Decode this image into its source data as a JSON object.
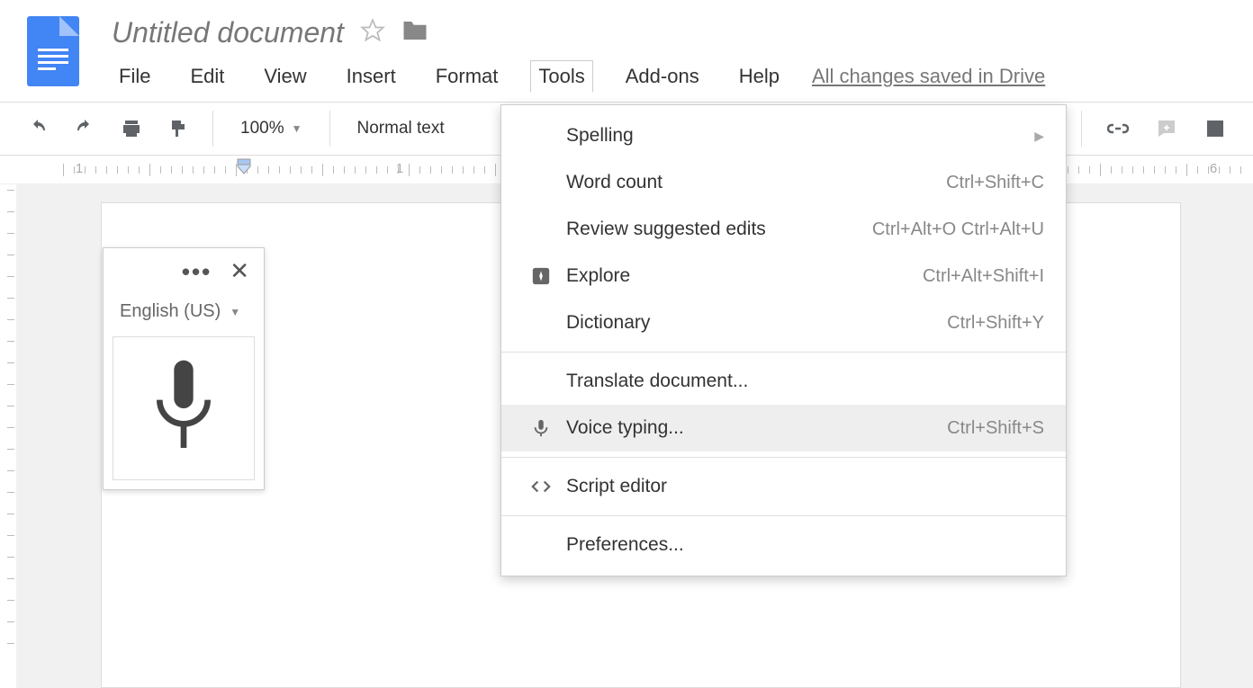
{
  "doc": {
    "title": "Untitled document",
    "save_status": "All changes saved in Drive"
  },
  "menus": {
    "file": "File",
    "edit": "Edit",
    "view": "View",
    "insert": "Insert",
    "format": "Format",
    "tools": "Tools",
    "addons": "Add-ons",
    "help": "Help"
  },
  "toolbar": {
    "zoom": "100%",
    "style": "Normal text"
  },
  "voice_panel": {
    "language": "English (US)"
  },
  "tools_menu": {
    "spelling": {
      "label": "Spelling",
      "shortcut": ""
    },
    "word_count": {
      "label": "Word count",
      "shortcut": "Ctrl+Shift+C"
    },
    "review": {
      "label": "Review suggested edits",
      "shortcut": "Ctrl+Alt+O Ctrl+Alt+U"
    },
    "explore": {
      "label": "Explore",
      "shortcut": "Ctrl+Alt+Shift+I"
    },
    "dictionary": {
      "label": "Dictionary",
      "shortcut": "Ctrl+Shift+Y"
    },
    "translate": {
      "label": "Translate document...",
      "shortcut": ""
    },
    "voice": {
      "label": "Voice typing...",
      "shortcut": "Ctrl+Shift+S"
    },
    "script": {
      "label": "Script editor",
      "shortcut": ""
    },
    "prefs": {
      "label": "Preferences...",
      "shortcut": ""
    }
  },
  "ruler": {
    "labels": [
      "1",
      "1",
      "6"
    ]
  }
}
